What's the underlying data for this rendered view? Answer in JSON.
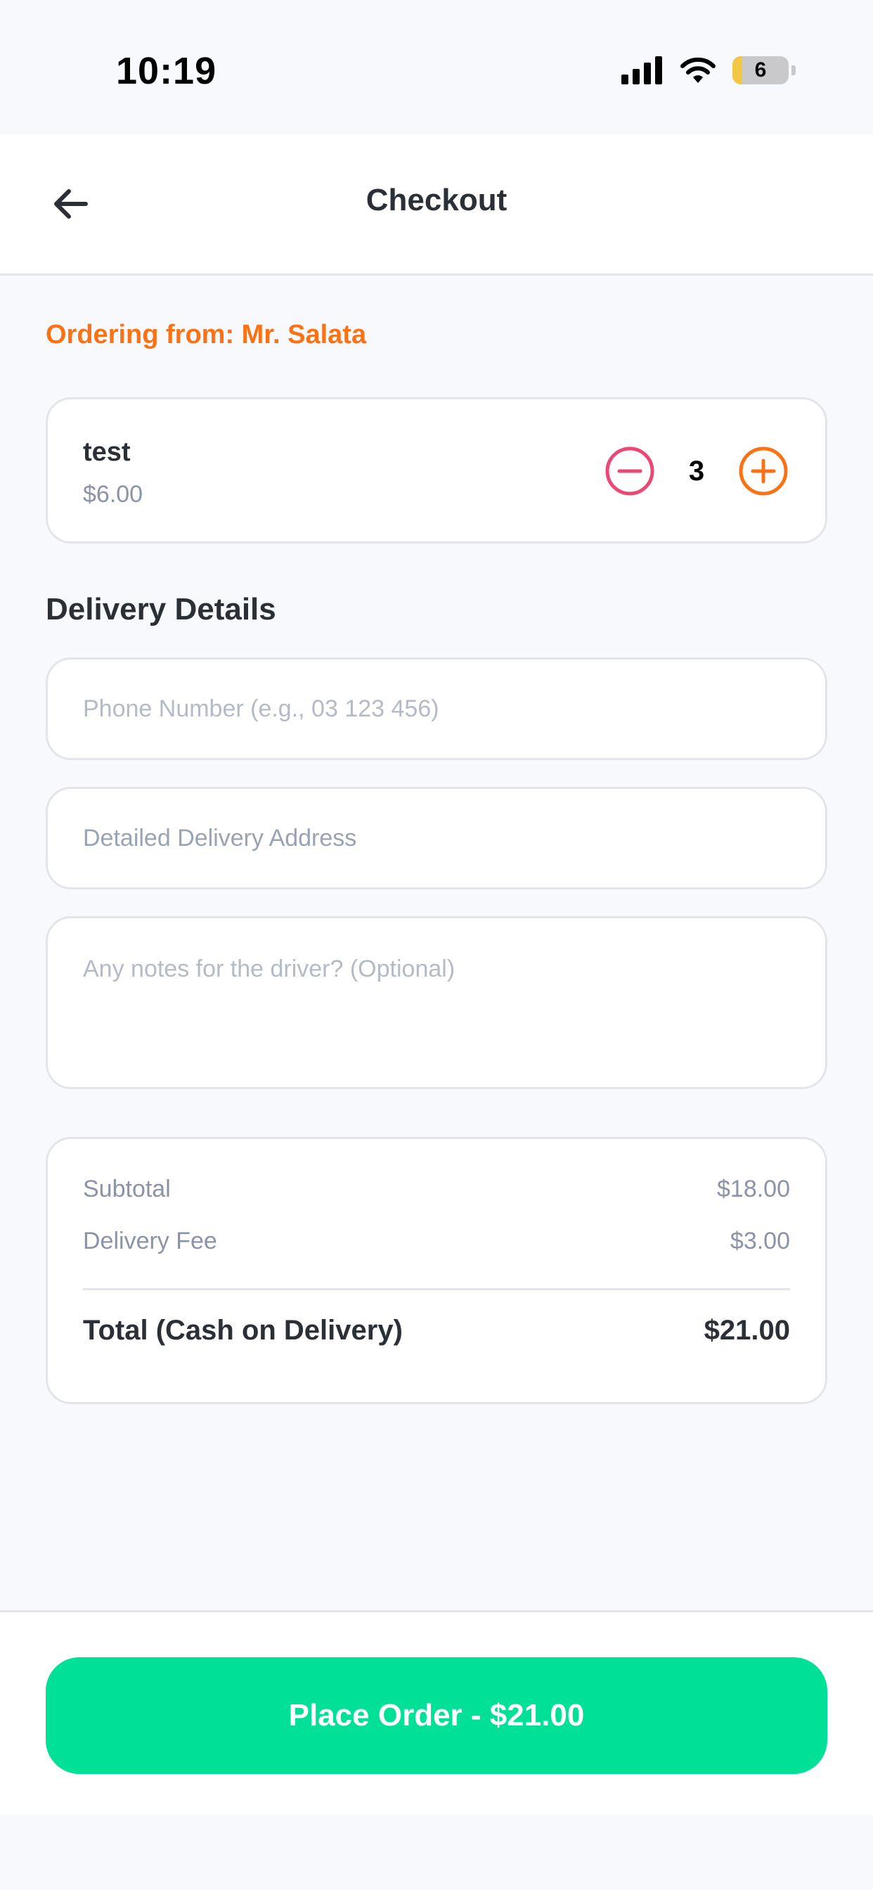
{
  "status_bar": {
    "time": "10:19",
    "battery_level": "6",
    "icons": [
      "cellular-signal-icon",
      "wifi-icon",
      "battery-icon"
    ]
  },
  "header": {
    "title": "Checkout",
    "back_icon": "arrow-left-icon"
  },
  "ordering_from": "Ordering from: Mr. Salata",
  "cart": {
    "items": [
      {
        "name": "test",
        "price": "$6.00",
        "quantity": "3"
      }
    ],
    "decrement_icon": "minus-circle-icon",
    "increment_icon": "plus-circle-icon"
  },
  "delivery": {
    "section_title": "Delivery Details",
    "phone_placeholder": "Phone Number (e.g., 03 123 456)",
    "phone_value": "",
    "address_placeholder": "Detailed Delivery Address",
    "address_value": "",
    "notes_placeholder": "Any notes for the driver? (Optional)",
    "notes_value": ""
  },
  "summary": {
    "subtotal_label": "Subtotal",
    "subtotal_value": "$18.00",
    "fee_label": "Delivery Fee",
    "fee_value": "$3.00",
    "total_label": "Total (Cash on Delivery)",
    "total_value": "$21.00"
  },
  "actions": {
    "place_order_label": "Place Order - $21.00"
  },
  "colors": {
    "accent_orange": "#f97316",
    "decrement_pink": "#ec4874",
    "primary_green": "#00e096",
    "background": "#f8f9fc"
  }
}
